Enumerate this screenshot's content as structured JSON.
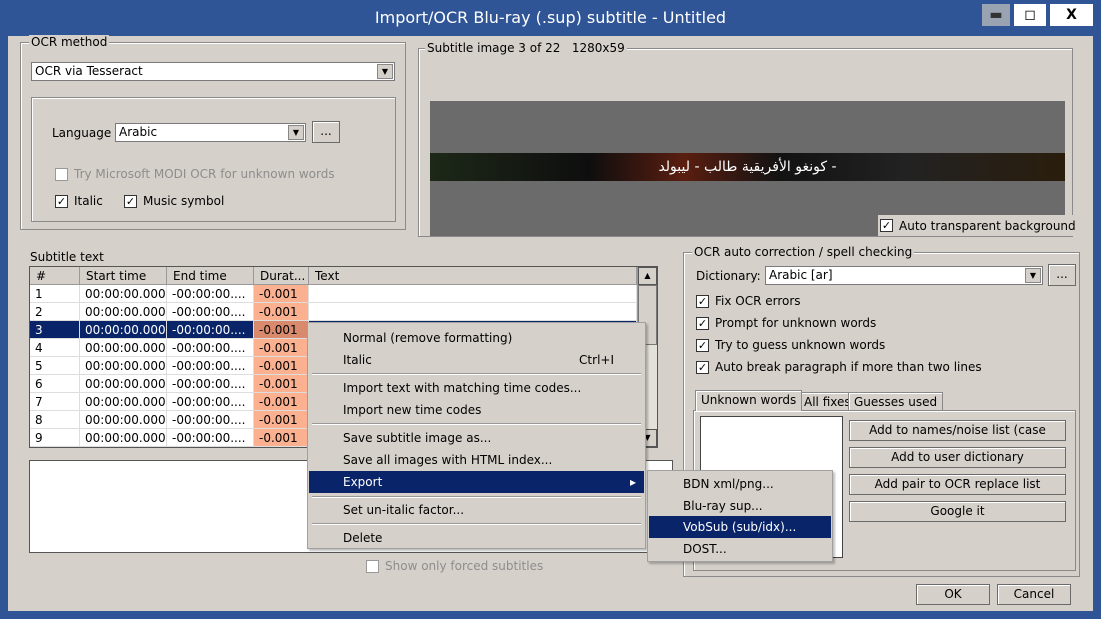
{
  "window": {
    "title": "Import/OCR Blu-ray (.sup) subtitle - Untitled",
    "minimize": "▬",
    "maximize": "◻",
    "close": "X"
  },
  "ocr_method": {
    "legend": "OCR method",
    "selected": "OCR via Tesseract",
    "language_label": "Language",
    "language": "Arabic",
    "browse": "...",
    "modi_label": "Try Microsoft MODI OCR for unknown words",
    "modi_checked": false,
    "italic_label": "Italic",
    "italic_checked": true,
    "music_label": "Music symbol",
    "music_checked": true
  },
  "subtitle_image": {
    "legend": "Subtitle image 3 of 22   1280x59",
    "image_text": "- كونغو الأفريقية طالب - ليبولد",
    "auto_transparent_label": "Auto transparent background",
    "auto_transparent_checked": true
  },
  "subtitle_text": {
    "label": "Subtitle text",
    "columns": [
      "#",
      "Start time",
      "End time",
      "Durat...",
      "Text"
    ],
    "rows": [
      {
        "n": "1",
        "start": "00:00:00.000",
        "end": "-00:00:00....",
        "dur": "-0.001",
        "text": ""
      },
      {
        "n": "2",
        "start": "00:00:00.000",
        "end": "-00:00:00....",
        "dur": "-0.001",
        "text": ""
      },
      {
        "n": "3",
        "start": "00:00:00.000",
        "end": "-00:00:00....",
        "dur": "-0.001",
        "text": ""
      },
      {
        "n": "4",
        "start": "00:00:00.000",
        "end": "-00:00:00....",
        "dur": "-0.001",
        "text": ""
      },
      {
        "n": "5",
        "start": "00:00:00.000",
        "end": "-00:00:00....",
        "dur": "-0.001",
        "text": ""
      },
      {
        "n": "6",
        "start": "00:00:00.000",
        "end": "-00:00:00....",
        "dur": "-0.001",
        "text": ""
      },
      {
        "n": "7",
        "start": "00:00:00.000",
        "end": "-00:00:00....",
        "dur": "-0.001",
        "text": ""
      },
      {
        "n": "8",
        "start": "00:00:00.000",
        "end": "-00:00:00....",
        "dur": "-0.001",
        "text": ""
      },
      {
        "n": "9",
        "start": "00:00:00.000",
        "end": "-00:00:00....",
        "dur": "-0.001",
        "text": ""
      }
    ],
    "forced_label": "Show only forced subtitles"
  },
  "context_menu": {
    "items": [
      "Normal (remove formatting)",
      "Italic",
      "Import text with matching time codes...",
      "Import new time codes",
      "Save subtitle image as...",
      "Save all images with HTML index...",
      "Export",
      "Set un-italic factor...",
      "Delete"
    ],
    "italic_shortcut": "Ctrl+I",
    "submenu_arrow": "▸"
  },
  "export_submenu": {
    "items": [
      "BDN xml/png...",
      "Blu-ray sup...",
      "VobSub (sub/idx)...",
      "DOST..."
    ]
  },
  "correction": {
    "legend": "OCR auto correction / spell checking",
    "dictionary_label": "Dictionary:",
    "dictionary": "Arabic [ar]",
    "browse": "...",
    "options": [
      {
        "label": "Fix OCR errors",
        "checked": true
      },
      {
        "label": "Prompt for unknown words",
        "checked": true
      },
      {
        "label": "Try to guess unknown words",
        "checked": true
      },
      {
        "label": "Auto break paragraph if more than two lines",
        "checked": true
      }
    ],
    "tabs": [
      "Unknown words",
      "All fixes",
      "Guesses used"
    ],
    "buttons": [
      "Add to names/noise list (case",
      "Add to user dictionary",
      "Add pair to OCR replace list",
      "Google it"
    ]
  },
  "footer": {
    "ok": "OK",
    "cancel": "Cancel"
  },
  "colors": {
    "title_bar": "#2f5597",
    "selection": "#0a246a",
    "duration_bg": "#fbb090"
  }
}
